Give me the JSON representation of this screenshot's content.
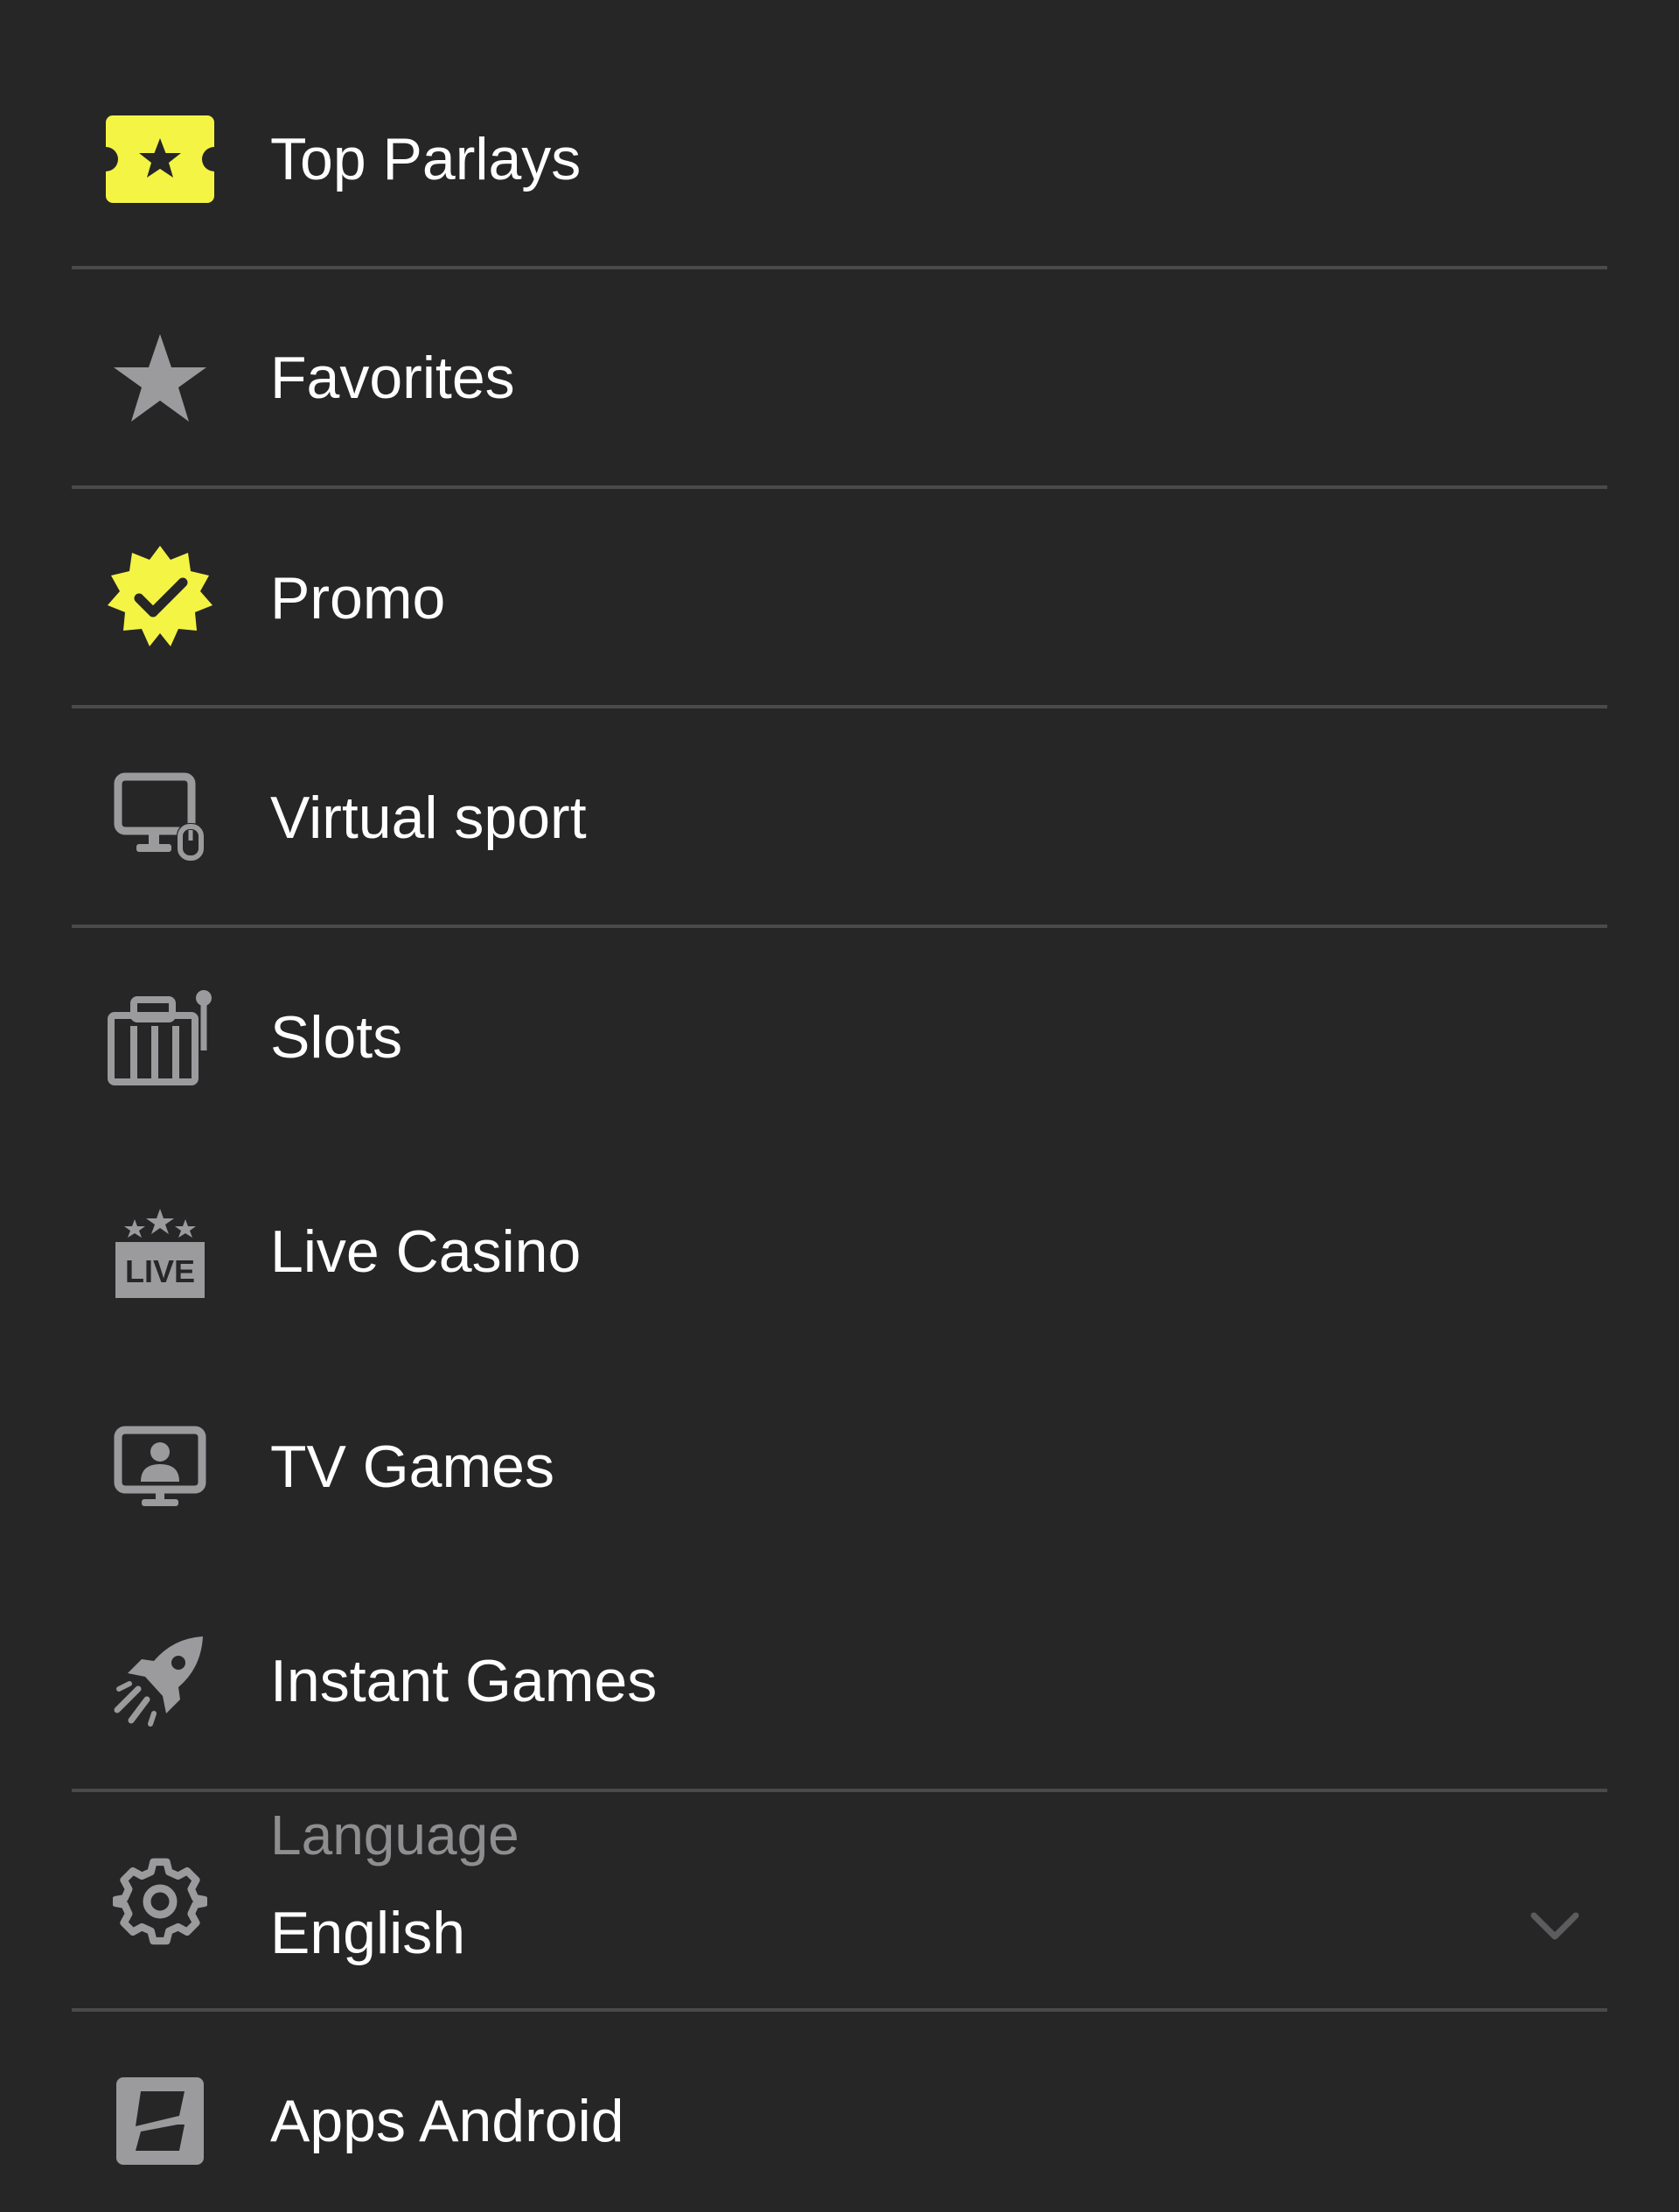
{
  "menu": {
    "items": [
      {
        "label": "Top Parlays",
        "icon": "ticket-star-icon",
        "icon_color": "#f4f445"
      },
      {
        "label": "Favorites",
        "icon": "star-icon",
        "icon_color": "#9b9b9d"
      },
      {
        "label": "Promo",
        "icon": "badge-check-icon",
        "icon_color": "#f4f445"
      },
      {
        "label": "Virtual sport",
        "icon": "monitor-mouse-icon",
        "icon_color": "#9b9b9d"
      },
      {
        "label": "Slots",
        "icon": "slot-machine-icon",
        "icon_color": "#9b9b9d"
      },
      {
        "label": "Live Casino",
        "icon": "live-stars-icon",
        "icon_color": "#9b9b9d",
        "icon_text": "LIVE"
      },
      {
        "label": "TV Games",
        "icon": "tv-presenter-icon",
        "icon_color": "#9b9b9d"
      },
      {
        "label": "Instant Games",
        "icon": "rocket-icon",
        "icon_color": "#9b9b9d"
      }
    ],
    "language": {
      "caption": "Language",
      "value": "English",
      "icon": "gear-icon",
      "dropdown_icon": "chevron-down-icon"
    },
    "apps": {
      "label": "Apps Android",
      "icon": "app-logo-icon"
    }
  },
  "colors": {
    "background": "#262627",
    "divider": "#4a4a4c",
    "accent": "#f4f445",
    "icon_gray": "#9b9b9d",
    "text": "#ffffff",
    "caption": "#8e8e90"
  }
}
